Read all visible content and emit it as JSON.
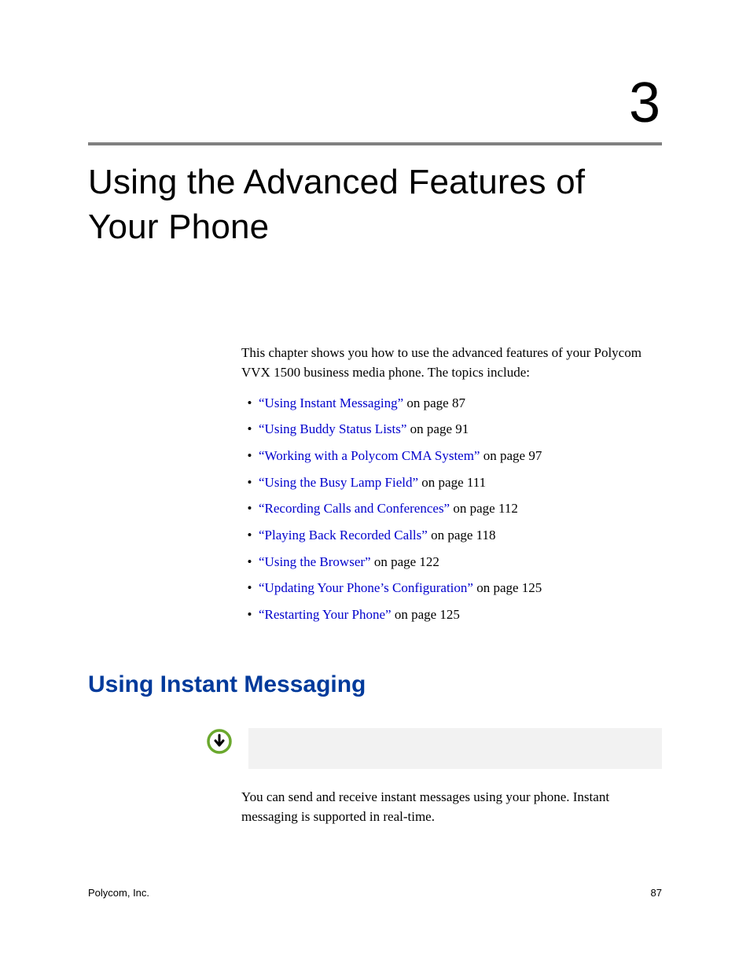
{
  "chapter": {
    "number": "3",
    "title": "Using the Advanced Features of Your Phone"
  },
  "intro": "This chapter shows you how to use the advanced features of your Polycom VVX 1500 business media phone. The topics include:",
  "topics": [
    {
      "link": "“Using Instant Messaging”",
      "rest": " on page 87"
    },
    {
      "link": "“Using Buddy Status Lists”",
      "rest": " on page 91"
    },
    {
      "link": "“Working with a Polycom CMA System”",
      "rest": " on page 97"
    },
    {
      "link": "“Using the Busy Lamp Field”",
      "rest": " on page 111"
    },
    {
      "link": "“Recording Calls and Conferences”",
      "rest": " on page 112"
    },
    {
      "link": "“Playing Back Recorded Calls”",
      "rest": " on page 118"
    },
    {
      "link": "“Using the Browser”",
      "rest": " on page 122"
    },
    {
      "link": "“Updating Your Phone’s Configuration”",
      "rest": " on page 125"
    },
    {
      "link": "“Restarting Your Phone”",
      "rest": " on page 125"
    }
  ],
  "section": {
    "heading": "Using Instant Messaging",
    "body": "You can send and receive instant messages using your phone. Instant messaging is supported in real-time."
  },
  "footer": {
    "left": "Polycom, Inc.",
    "right": "87"
  }
}
